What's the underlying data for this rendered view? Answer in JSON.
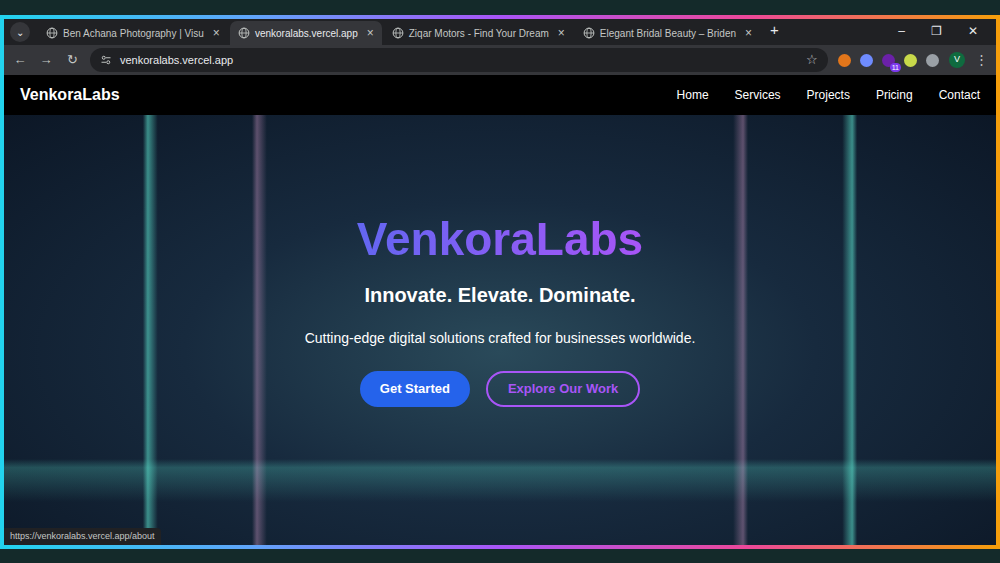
{
  "browser": {
    "tab_menu": "⌄",
    "tabs": [
      {
        "label": "Ben Achana Photography | Visu",
        "selected": false
      },
      {
        "label": "venkoralabs.vercel.app",
        "selected": true
      },
      {
        "label": "Ziqar Motors - Find Your Dream",
        "selected": false
      },
      {
        "label": "Elegant Bridal Beauty – Briden",
        "selected": false
      }
    ],
    "tab_close": "×",
    "new_tab": "+",
    "window_controls": [
      "–",
      "❐",
      "✕"
    ],
    "nav_buttons": [
      "←",
      "→",
      "↻"
    ],
    "address": "venkoralabs.vercel.app",
    "star": "☆",
    "extensions": [
      {
        "color": "#e2761b",
        "badge": ""
      },
      {
        "color": "#6f8cff",
        "badge": ""
      },
      {
        "color": "#6b21a8",
        "badge": "11"
      },
      {
        "color": "#c8d94a",
        "badge": ""
      },
      {
        "color": "#9aa0a6",
        "badge": ""
      }
    ],
    "profile": "V",
    "menu": "⋮"
  },
  "site": {
    "brand": "VenkoraLabs",
    "nav": [
      "Home",
      "Services",
      "Projects",
      "Pricing",
      "Contact"
    ],
    "hero": {
      "title": "VenkoraLabs",
      "tagline": "Innovate. Elevate. Dominate.",
      "subtitle": "Cutting-edge digital solutions crafted for businesses worldwide.",
      "buttons": [
        {
          "label": "Get Started",
          "kind": "solid"
        },
        {
          "label": "Explore Our Work",
          "kind": "outline"
        }
      ]
    }
  },
  "status_bar": "https://venkoralabs.vercel.app/about"
}
